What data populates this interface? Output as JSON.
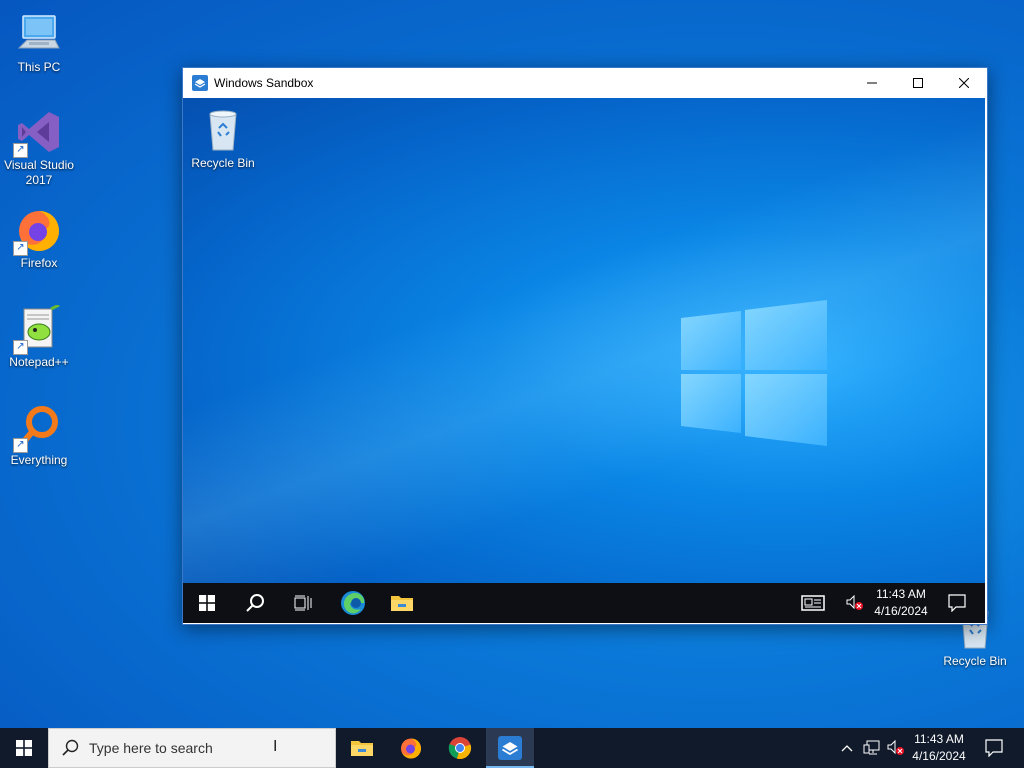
{
  "desktop": {
    "icons": [
      {
        "label": "This PC"
      },
      {
        "label": "Visual Studio 2017"
      },
      {
        "label": "Firefox"
      },
      {
        "label": "Notepad++"
      },
      {
        "label": "Everything"
      },
      {
        "label": "Recycle Bin"
      }
    ]
  },
  "window": {
    "title": "Windows Sandbox",
    "buttons": {
      "minimize": "minimize-icon",
      "maximize": "maximize-icon",
      "close": "close-icon"
    }
  },
  "sandbox": {
    "desktop_icons": [
      {
        "label": "Recycle Bin"
      }
    ],
    "taskbar": {
      "time": "11:43 AM",
      "date": "4/16/2024",
      "items": [
        "start-icon",
        "search-icon",
        "task-view-icon",
        "edge-icon",
        "file-explorer-icon"
      ]
    }
  },
  "taskbar": {
    "search_placeholder": "Type here to search",
    "time": "11:43 AM",
    "date": "4/16/2024",
    "pinned": [
      "file-explorer-icon",
      "firefox-icon",
      "chrome-icon",
      "windows-sandbox-icon"
    ],
    "active_app": "Windows Sandbox"
  },
  "colors": {
    "desktop_bg": "#0a78d8",
    "taskbar_bg": "#101a2b",
    "inner_taskbar_bg": "#0d0f14",
    "active_indicator": "#77b7f0"
  }
}
